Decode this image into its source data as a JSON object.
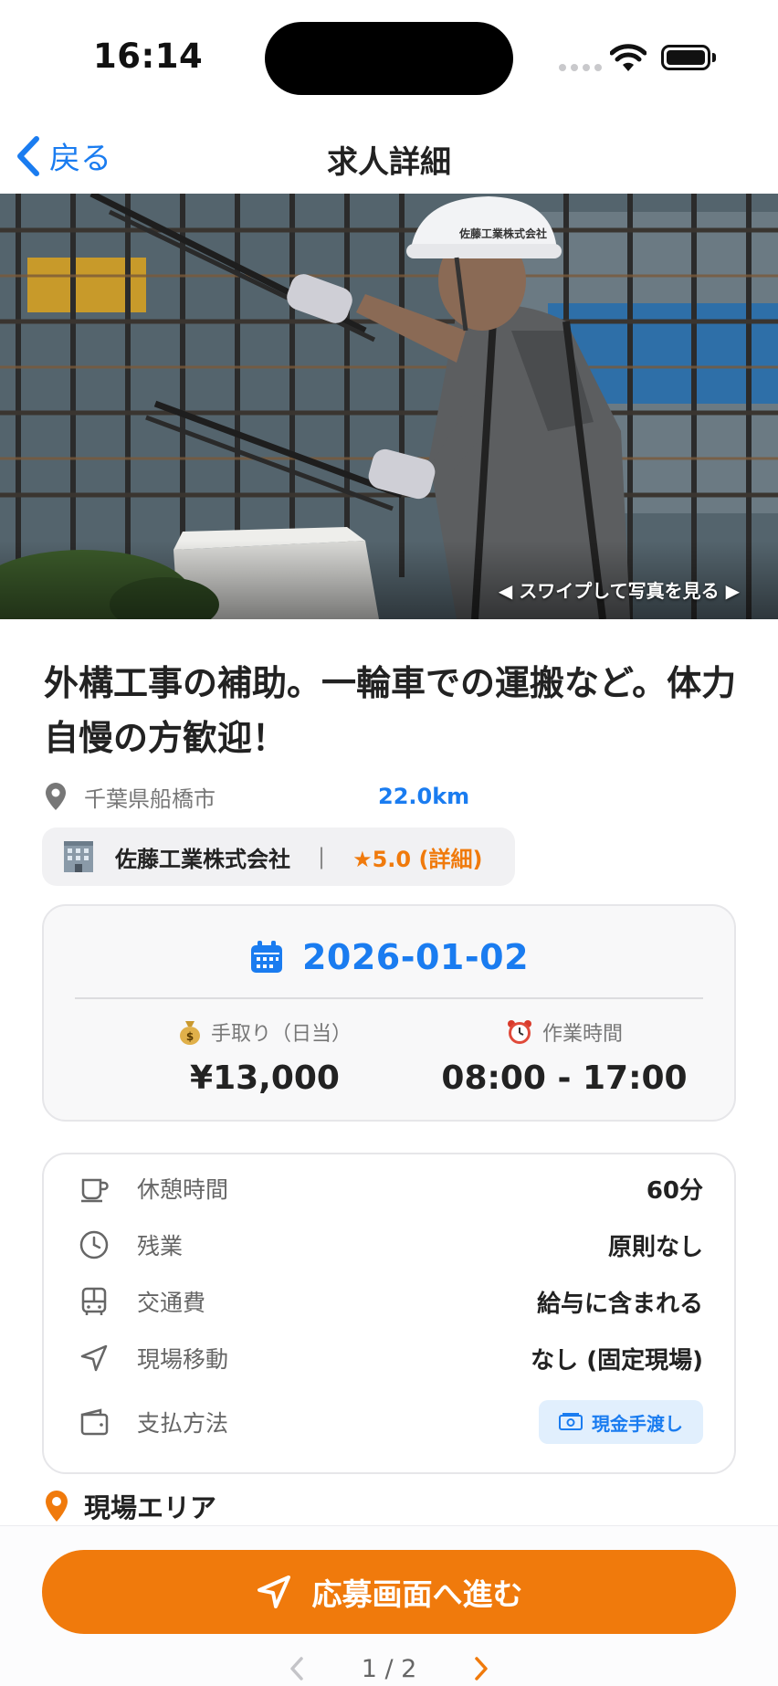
{
  "status_bar": {
    "time": "16:14"
  },
  "nav": {
    "back_label": "戻る",
    "title": "求人詳細"
  },
  "hero": {
    "swipe_hint": "◀ スワイプして写真を見る ▶",
    "helmet_text": "佐藤工業株式会社"
  },
  "job": {
    "title": "外構工事の補助。一輪車での運搬など。体力自慢の方歓迎！",
    "location": "千葉県船橋市",
    "distance": "22.0km"
  },
  "company": {
    "name": "佐藤工業株式会社",
    "separator": "|",
    "rating": "★5.0 (詳細)"
  },
  "schedule": {
    "date": "2026-01-02",
    "pay_label": "手取り（日当）",
    "pay_value": "¥13,000",
    "hours_label": "作業時間",
    "hours_value": "08:00 - 17:00"
  },
  "details": [
    {
      "icon": "coffee-cup-icon",
      "label": "休憩時間",
      "value": "60分"
    },
    {
      "icon": "clock-icon",
      "label": "残業",
      "value": "原則なし"
    },
    {
      "icon": "bus-icon",
      "label": "交通費",
      "value": "給与に含まれる"
    },
    {
      "icon": "navigation-arrow-icon",
      "label": "現場移動",
      "value": "なし (固定現場)"
    },
    {
      "icon": "wallet-icon",
      "label": "支払方法",
      "value": "現金手渡し"
    }
  ],
  "area": {
    "heading": "現場エリア"
  },
  "bottom": {
    "apply_label": "応募画面へ進む",
    "page_indicator": "1 / 2"
  },
  "colors": {
    "accent_blue": "#1a7cf0",
    "accent_orange": "#f07a0c"
  }
}
